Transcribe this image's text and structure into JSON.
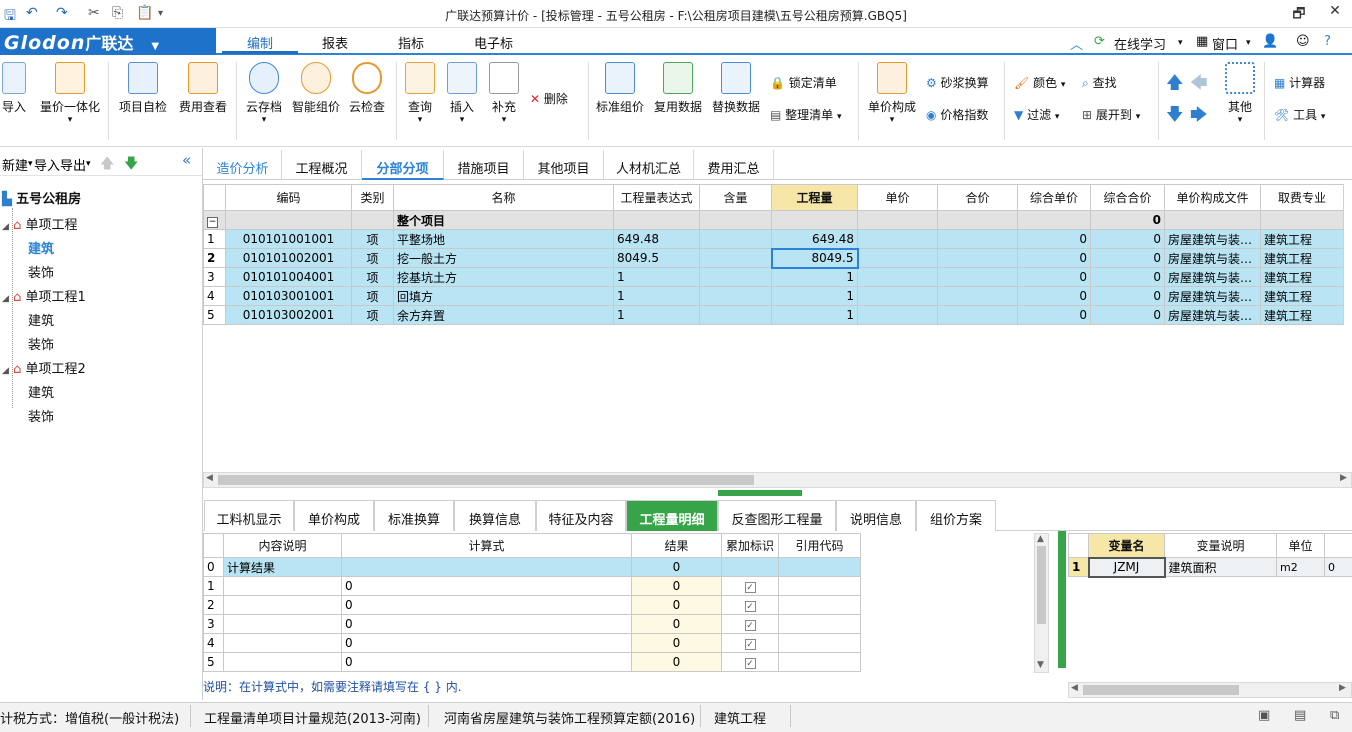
{
  "window": {
    "title": "广联达预算计价 - [投标管理 - 五号公租房 - F:\\公租房项目建模\\五号公租房预算.GBQ5]"
  },
  "menubar": {
    "logo": "Glodon",
    "logo_cn": "广联达",
    "tabs": [
      "编制",
      "报表",
      "指标",
      "电子标"
    ],
    "online_learning": "在线学习",
    "window_menu": "窗口"
  },
  "ribbon": {
    "import": "导入",
    "quantity_price": "量价一体化",
    "self_check": "项目自检",
    "fee_view": "费用查看",
    "cloud_save": "云存档",
    "smart_price": "智能组价",
    "cloud_check": "云检查",
    "query": "查询",
    "insert": "插入",
    "supplement": "补充",
    "delete": "删除",
    "std_price": "标准组价",
    "reuse_data": "复用数据",
    "replace_data": "替换数据",
    "lock_list": "锁定清单",
    "organize_list": "整理清单",
    "unit_price_comp": "单价构成",
    "mortar_convert": "砂浆换算",
    "price_index": "价格指数",
    "color": "颜色",
    "find": "查找",
    "filter": "过滤",
    "expand_to": "展开到",
    "other": "其他",
    "calculator": "计算器",
    "tools": "工具"
  },
  "left_toolbar": {
    "new": "新建",
    "import_export": "导入导出"
  },
  "tree": [
    {
      "label": "五号公租房",
      "level": 0,
      "bold": true
    },
    {
      "label": "单项工程",
      "level": 1
    },
    {
      "label": "建筑",
      "level": 2,
      "selected": true
    },
    {
      "label": "装饰",
      "level": 2
    },
    {
      "label": "单项工程1",
      "level": 1
    },
    {
      "label": "建筑",
      "level": 2
    },
    {
      "label": "装饰",
      "level": 2
    },
    {
      "label": "单项工程2",
      "level": 1
    },
    {
      "label": "建筑",
      "level": 2
    },
    {
      "label": "装饰",
      "level": 2
    }
  ],
  "main_tabs": [
    "造价分析",
    "工程概况",
    "分部分项",
    "措施项目",
    "其他项目",
    "人材机汇总",
    "费用汇总"
  ],
  "main_grid": {
    "headers": [
      "编码",
      "类别",
      "名称",
      "工程量表达式",
      "含量",
      "工程量",
      "单价",
      "合价",
      "综合单价",
      "综合合价",
      "单价构成文件",
      "取费专业"
    ],
    "group_row": {
      "name": "整个项目",
      "total": "0"
    },
    "rows": [
      {
        "no": "1",
        "code": "010101001001",
        "type": "项",
        "name": "平整场地",
        "expr": "649.48",
        "qty": "649.48",
        "unit_total": "0",
        "total": "0",
        "file": "房屋建筑与装…",
        "major": "建筑工程"
      },
      {
        "no": "2",
        "code": "010101002001",
        "type": "项",
        "name": "挖一般土方",
        "expr": "8049.5",
        "qty": "8049.5",
        "unit_total": "0",
        "total": "0",
        "file": "房屋建筑与装…",
        "major": "建筑工程"
      },
      {
        "no": "3",
        "code": "010101004001",
        "type": "项",
        "name": "挖基坑土方",
        "expr": "1",
        "qty": "1",
        "unit_total": "0",
        "total": "0",
        "file": "房屋建筑与装…",
        "major": "建筑工程"
      },
      {
        "no": "4",
        "code": "010103001001",
        "type": "项",
        "name": "回填方",
        "expr": "1",
        "qty": "1",
        "unit_total": "0",
        "total": "0",
        "file": "房屋建筑与装…",
        "major": "建筑工程"
      },
      {
        "no": "5",
        "code": "010103002001",
        "type": "项",
        "name": "余方弃置",
        "expr": "1",
        "qty": "1",
        "unit_total": "0",
        "total": "0",
        "file": "房屋建筑与装…",
        "major": "建筑工程"
      }
    ]
  },
  "bottom_tabs": [
    "工料机显示",
    "单价构成",
    "标准换算",
    "换算信息",
    "特征及内容",
    "工程量明细",
    "反查图形工程量",
    "说明信息",
    "组价方案"
  ],
  "detail_grid": {
    "headers": [
      "内容说明",
      "计算式",
      "结果",
      "累加标识",
      "引用代码"
    ],
    "rows": [
      {
        "no": "0",
        "desc": "计算结果",
        "formula": "",
        "result": "0",
        "check": false
      },
      {
        "no": "1",
        "desc": "",
        "formula": "0",
        "result": "0",
        "check": true
      },
      {
        "no": "2",
        "desc": "",
        "formula": "0",
        "result": "0",
        "check": true
      },
      {
        "no": "3",
        "desc": "",
        "formula": "0",
        "result": "0",
        "check": true
      },
      {
        "no": "4",
        "desc": "",
        "formula": "0",
        "result": "0",
        "check": true
      },
      {
        "no": "5",
        "desc": "",
        "formula": "0",
        "result": "0",
        "check": true
      }
    ],
    "note": "说明：在计算式中，如需要注释请填写在 { } 内."
  },
  "var_grid": {
    "headers": [
      "变量名",
      "变量说明",
      "单位"
    ],
    "rows": [
      {
        "no": "1",
        "name": "JZMJ",
        "desc": "建筑面积",
        "unit": "m2",
        "value": "0"
      }
    ]
  },
  "status": {
    "tax": "计税方式：增值税(一般计税法)",
    "spec": "工程量清单项目计量规范(2013-河南)",
    "quota": "河南省房屋建筑与装饰工程预算定额(2016)",
    "major": "建筑工程"
  },
  "colors": {
    "accent": "#2b85d6",
    "selected_row": "#b9e4f4",
    "active_bottom_tab": "#37a44a",
    "highlight_col": "#f6e7a8"
  }
}
